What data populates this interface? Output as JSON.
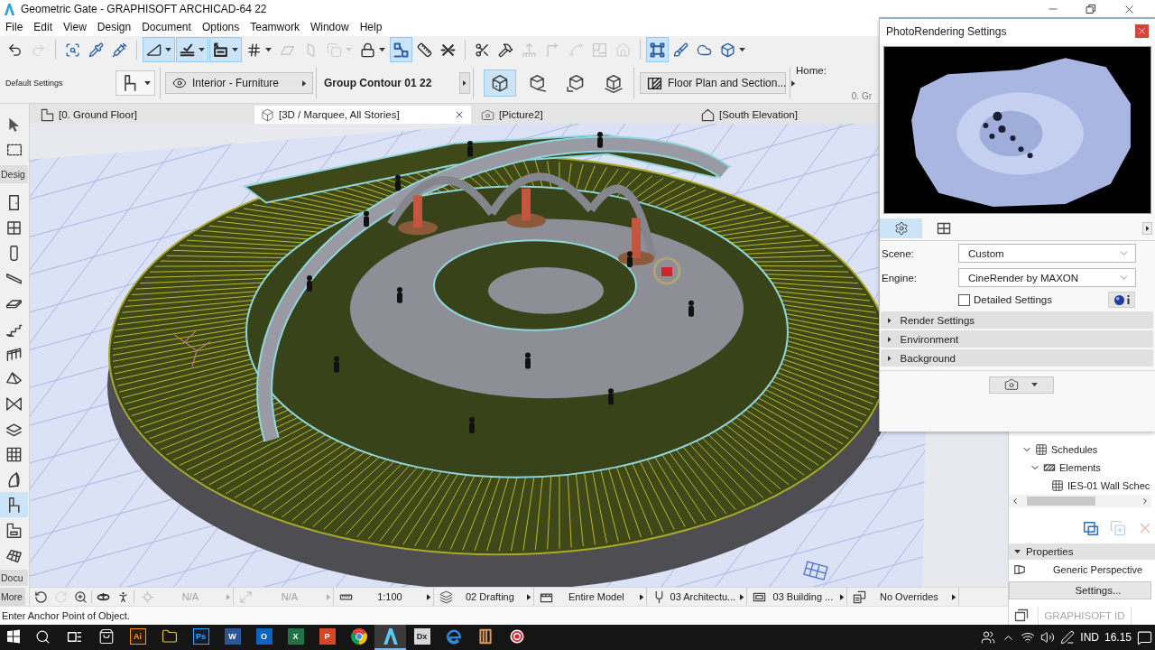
{
  "window": {
    "title": "Geometric Gate - GRAPHISOFT ARCHICAD-64 22"
  },
  "menu": [
    "File",
    "Edit",
    "View",
    "Design",
    "Document",
    "Options",
    "Teamwork",
    "Window",
    "Help"
  ],
  "toolbar": [
    [
      {
        "selected": false,
        "disabled": false
      },
      {
        "selected": false,
        "disabled": true
      }
    ],
    [
      {
        "selected": false,
        "disabled": false
      },
      {
        "selected": false,
        "disabled": false
      },
      {
        "selected": false,
        "disabled": false
      }
    ],
    [
      {
        "selected": true,
        "disabled": false
      },
      {
        "selected": true,
        "disabled": false
      },
      {
        "selected": true,
        "disabled": false
      },
      {
        "selected": false,
        "disabled": false
      },
      {
        "selected": false,
        "disabled": true
      },
      {
        "selected": false,
        "disabled": true
      },
      {
        "selected": false,
        "disabled": true
      },
      {
        "selected": false,
        "disabled": false
      },
      {
        "selected": true,
        "disabled": false
      },
      {
        "selected": false,
        "disabled": false
      },
      {
        "selected": false,
        "disabled": false
      }
    ],
    [
      {
        "selected": false,
        "disabled": false
      },
      {
        "selected": false,
        "disabled": false
      },
      {
        "selected": false,
        "disabled": true
      },
      {
        "selected": false,
        "disabled": true
      },
      {
        "selected": false,
        "disabled": true
      },
      {
        "selected": false,
        "disabled": true
      },
      {
        "selected": false,
        "disabled": true
      }
    ],
    [
      {
        "selected": true,
        "disabled": false
      },
      {
        "selected": false,
        "disabled": false
      },
      {
        "selected": false,
        "disabled": false
      },
      {
        "selected": false,
        "disabled": false
      }
    ]
  ],
  "info_box": {
    "label": "Default Settings",
    "layer": "Interior - Furniture",
    "title": "Group Contour 01 22",
    "geometry_methods": [
      {
        "selected": true
      },
      {
        "selected": false
      },
      {
        "selected": false
      },
      {
        "selected": false
      }
    ],
    "view": "Floor Plan and Section...",
    "home_label": "Home:",
    "home_value": "0. Gr"
  },
  "tabs": [
    {
      "label": "[0. Ground Floor]",
      "selected": false
    },
    {
      "label": "[3D / Marquee, All Stories]",
      "selected": true
    },
    {
      "label": "[Picture2]",
      "selected": false
    },
    {
      "label": "[South Elevation]",
      "selected": false
    }
  ],
  "toolbox": {
    "top_tools": [
      {
        "selected": false
      },
      {
        "selected": false
      }
    ],
    "sections": [
      {
        "label": "Desig",
        "tools": [
          {
            "selected": false
          },
          {
            "selected": false
          },
          {
            "selected": false
          },
          {
            "selected": false
          },
          {
            "selected": false
          },
          {
            "selected": false
          },
          {
            "selected": false
          },
          {
            "selected": false
          },
          {
            "selected": false
          },
          {
            "selected": false
          },
          {
            "selected": false
          },
          {
            "selected": false
          },
          {
            "selected": true
          },
          {
            "selected": false
          },
          {
            "selected": false
          }
        ]
      },
      {
        "label": "Docu"
      }
    ],
    "more": "More"
  },
  "quick_options": {
    "view_buttons": [
      {
        "disabled": false
      },
      {
        "disabled": true
      },
      {
        "disabled": false
      },
      {
        "disabled": false
      },
      {
        "disabled": false
      }
    ],
    "selectors": [
      {
        "value": "N/A",
        "disabled": true
      },
      {
        "value": "N/A",
        "disabled": true
      },
      {
        "value": "1:100",
        "disabled": false
      },
      {
        "value": "02 Drafting",
        "disabled": false
      },
      {
        "value": "Entire Model",
        "disabled": false
      },
      {
        "value": "03 Architectu...",
        "disabled": false
      },
      {
        "value": "03 Building ...",
        "disabled": false
      },
      {
        "value": "No Overrides",
        "disabled": false
      }
    ]
  },
  "status": "Enter Anchor Point of Object.",
  "photorendering": {
    "title": "PhotoRendering Settings",
    "tabs": [
      {
        "selected": true
      },
      {
        "selected": false
      }
    ],
    "fields": [
      {
        "label": "Scene:",
        "value": "Custom"
      },
      {
        "label": "Engine:",
        "value": "CineRender by MAXON"
      }
    ],
    "detailed_settings": {
      "label": "Detailed Settings",
      "checked": false
    },
    "sections": [
      {
        "label": "Render Settings",
        "expanded": false
      },
      {
        "label": "Environment",
        "expanded": false
      },
      {
        "label": "Background",
        "expanded": false
      }
    ]
  },
  "navigator": {
    "tree": [
      {
        "label": "Schedules",
        "expanded": true,
        "children": [
          {
            "label": "Elements",
            "expanded": true,
            "children": [
              {
                "label": "IES-01 Wall Schec"
              }
            ]
          }
        ]
      }
    ],
    "actions": [
      {
        "disabled": false
      },
      {
        "disabled": true
      },
      {
        "disabled": true
      }
    ],
    "properties": {
      "label": "Properties",
      "expanded": true,
      "view_name": "Generic Perspective",
      "button": "Settings..."
    },
    "id_label": "GRAPHISOFT ID"
  },
  "taskbar": {
    "apps": [
      {
        "selected": false
      },
      {
        "label": "Ai",
        "selected": false
      },
      {
        "selected": false
      },
      {
        "label": "Ps",
        "selected": false
      },
      {
        "label": "W",
        "selected": false
      },
      {
        "label": "O",
        "selected": false
      },
      {
        "label": "X",
        "selected": false
      },
      {
        "label": "P",
        "selected": false
      },
      {
        "selected": false
      },
      {
        "selected": true
      },
      {
        "label": "Dx",
        "selected": false
      },
      {
        "selected": false
      },
      {
        "selected": false
      },
      {
        "selected": false
      }
    ],
    "language": "IND",
    "time": "16.15"
  }
}
